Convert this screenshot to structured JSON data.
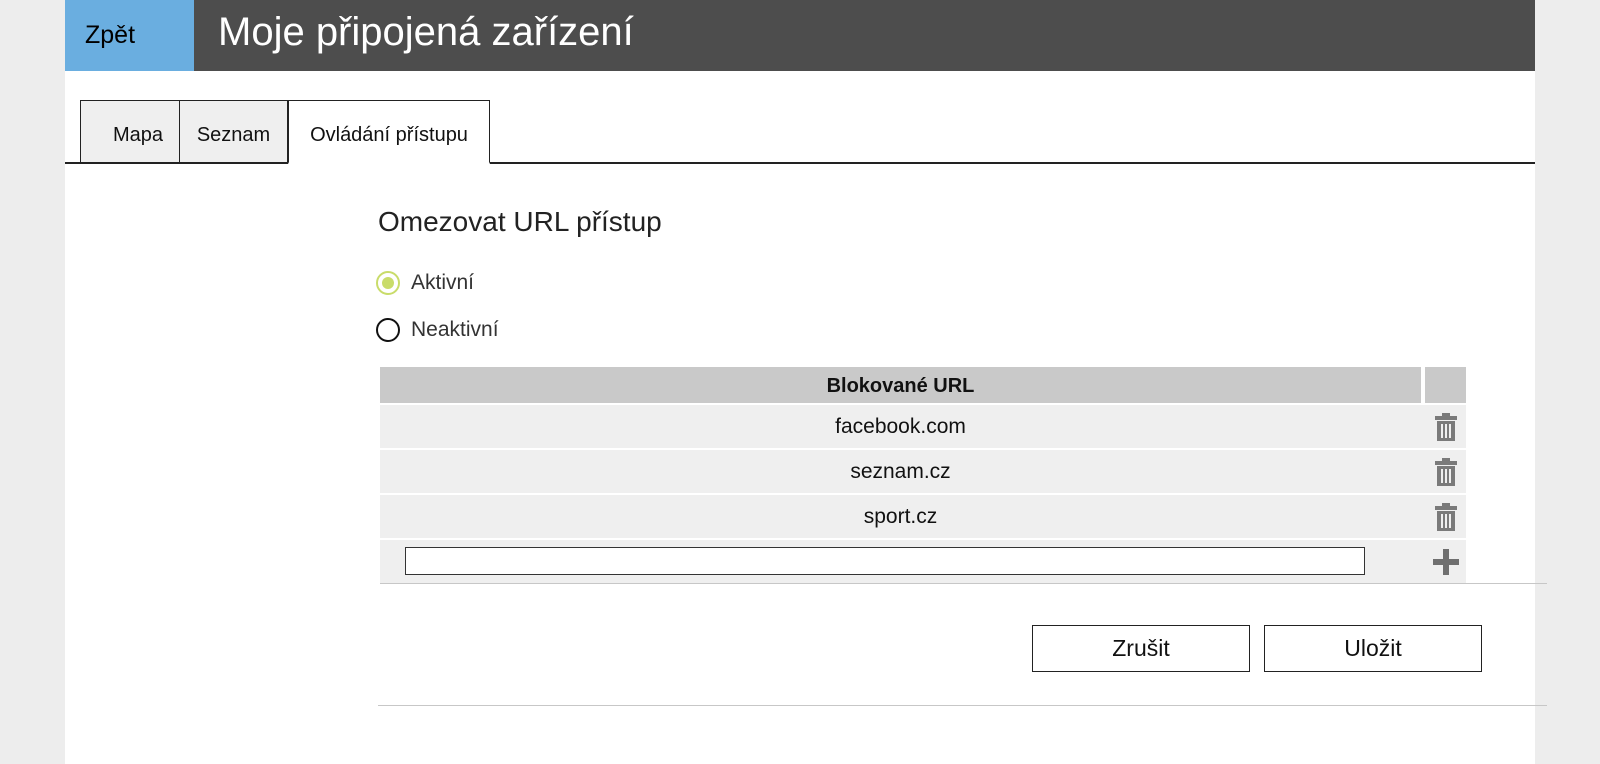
{
  "header": {
    "back_label": "Zpět",
    "title": "Moje připojená zařízení"
  },
  "tabs": [
    {
      "label": "Mapa",
      "active": false
    },
    {
      "label": "Seznam",
      "active": false
    },
    {
      "label": "Ovládání přístupu",
      "active": true
    }
  ],
  "access_control": {
    "section_title": "Omezovat URL přístup",
    "options": [
      {
        "label": "Aktivní",
        "checked": true
      },
      {
        "label": "Neaktivní",
        "checked": false
      }
    ],
    "table": {
      "column_header": "Blokované URL",
      "rows": [
        {
          "url": "facebook.com"
        },
        {
          "url": "seznam.cz"
        },
        {
          "url": "sport.cz"
        }
      ],
      "new_url_value": ""
    },
    "cancel_label": "Zrušit",
    "save_label": "Uložit"
  },
  "icons": {
    "delete": "trash-icon",
    "add": "plus-icon"
  },
  "colors": {
    "header_bg": "#4d4d4d",
    "back_button_bg": "#6aaee0",
    "radio_active": "#c9dc6a"
  }
}
